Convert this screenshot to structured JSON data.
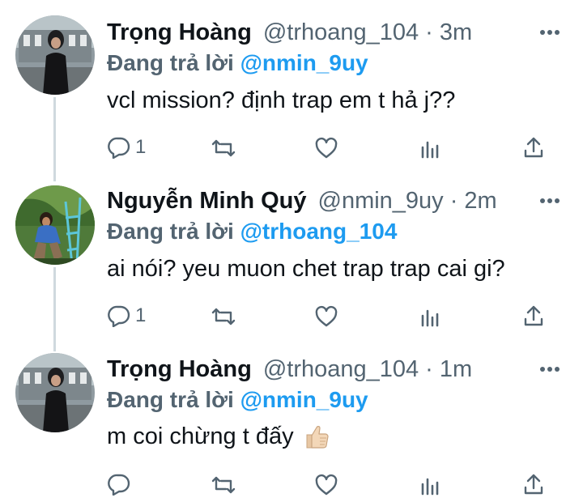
{
  "colors": {
    "accent": "#1d9bf0",
    "secondary_text": "#536471",
    "thread_line": "#cfd9de"
  },
  "tweets": [
    {
      "name": "Trọng Hoàng",
      "handle": "@trhoang_104",
      "separator": "·",
      "time": "3m",
      "replying_prefix": "Đang trả lời",
      "replying_to": "@nmin_9uy",
      "text": "vcl mission? định trap em t hả j??",
      "reply_count": "1",
      "icons": [
        "reply-icon",
        "retweet-icon",
        "like-icon",
        "analytics-icon",
        "share-icon",
        "more-icon"
      ]
    },
    {
      "name": "Nguyễn Minh Quý",
      "handle": "@nmin_9uy",
      "separator": "·",
      "time": "2m",
      "replying_prefix": "Đang trả lời",
      "replying_to": "@trhoang_104",
      "text": "ai nói? yeu muon chet trap trap cai gi?",
      "reply_count": "1",
      "icons": [
        "reply-icon",
        "retweet-icon",
        "like-icon",
        "analytics-icon",
        "share-icon",
        "more-icon"
      ]
    },
    {
      "name": "Trọng Hoàng",
      "handle": "@trhoang_104",
      "separator": "·",
      "time": "1m",
      "replying_prefix": "Đang trả lời",
      "replying_to": "@nmin_9uy",
      "text": "m coi chừng t đấy",
      "reply_count": "",
      "emoji": "thumbs-up-icon",
      "icons": [
        "reply-icon",
        "retweet-icon",
        "like-icon",
        "analytics-icon",
        "share-icon",
        "more-icon"
      ]
    }
  ]
}
